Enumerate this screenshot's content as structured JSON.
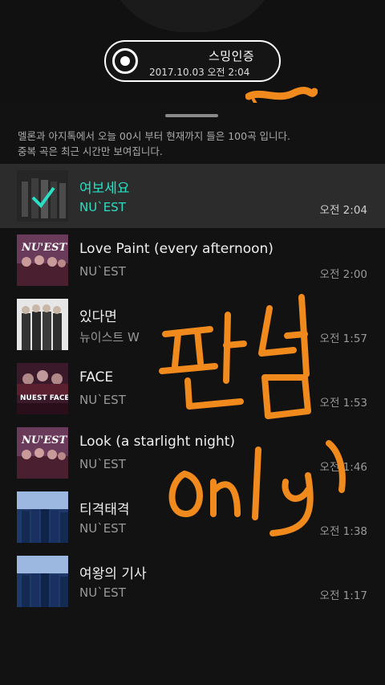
{
  "header": {
    "title": "스밍인증",
    "datetime": "2017.10.03 오전 2:04"
  },
  "notice": {
    "line1": "멜론과 아지톡에서 오늘 00시 부터 현재까지 들은 100곡 입니다.",
    "line2": "중복 곡은 최근 시간만 보여집니다."
  },
  "songs": [
    {
      "title": "여보세요",
      "artist": "NU`EST",
      "time": "오전 2:04",
      "selected": true
    },
    {
      "title": "Love Paint (every afternoon)",
      "artist": "NU`EST",
      "time": "오전 2:00"
    },
    {
      "title": "있다면",
      "artist": "뉴이스트 W",
      "time": "오전 1:57"
    },
    {
      "title": "FACE",
      "artist": "NU`EST",
      "time": "오전 1:53"
    },
    {
      "title": "Look (a starlight night)",
      "artist": "NU`EST",
      "time": "오전 1:46"
    },
    {
      "title": "티격태격",
      "artist": "NU`EST",
      "time": "오전 1:38"
    },
    {
      "title": "여왕의 기사",
      "artist": "NU`EST",
      "time": "오전 1:17"
    }
  ],
  "album_art": {
    "love_paint": "NU'EST",
    "face": "NUEST FACE"
  },
  "accent_color": "#29e0c4",
  "handwriting_color": "#f08a1c"
}
